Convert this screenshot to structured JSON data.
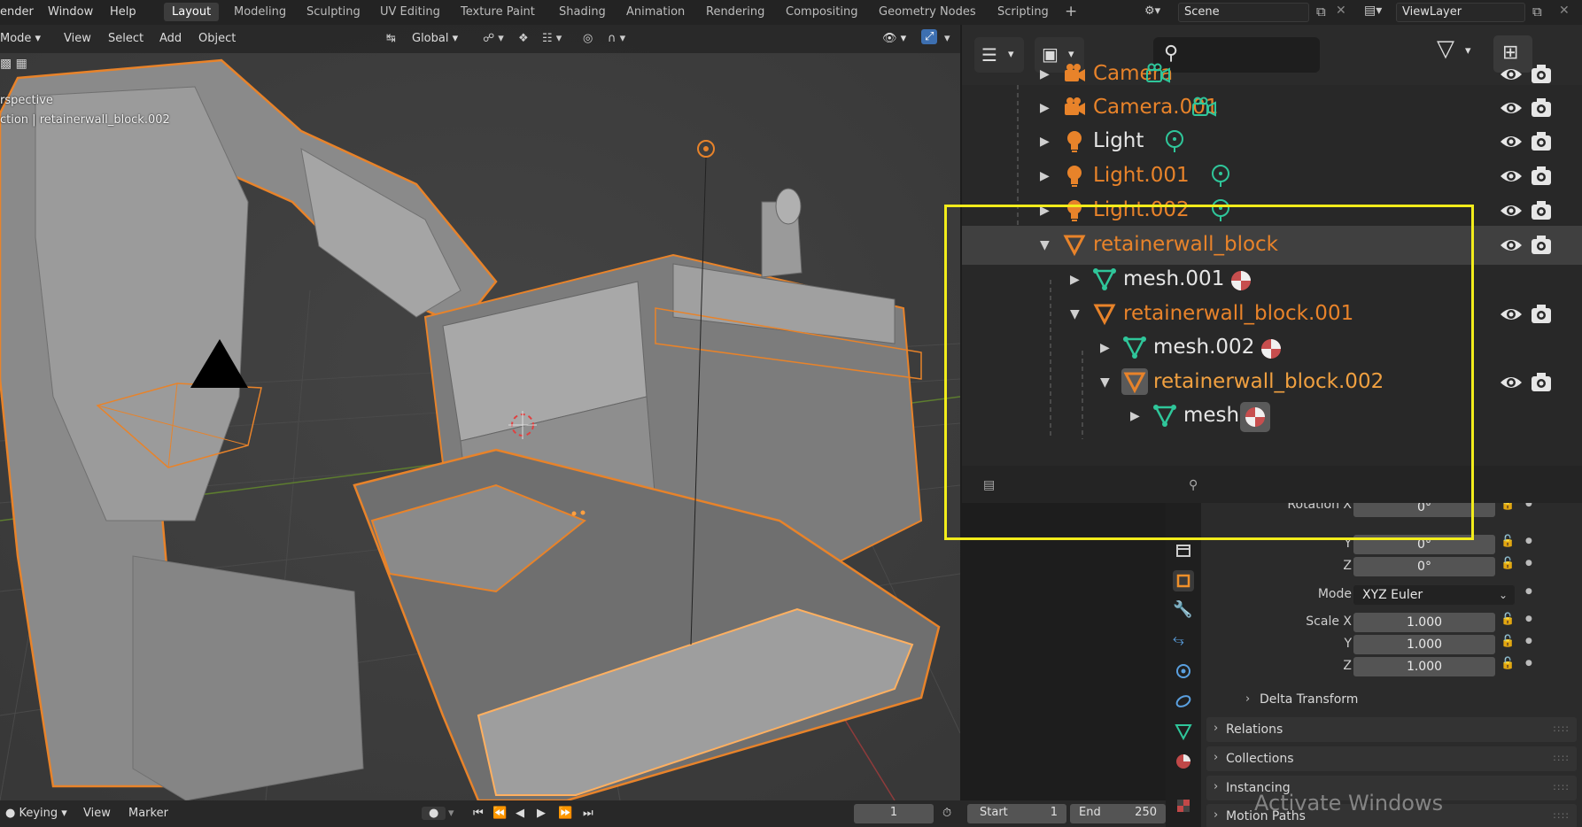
{
  "menu": {
    "items": [
      "ender",
      "Window",
      "Help"
    ],
    "workspaces": [
      "Layout",
      "Modeling",
      "Sculpting",
      "UV Editing",
      "Texture Paint",
      "Shading",
      "Animation",
      "Rendering",
      "Compositing",
      "Geometry Nodes",
      "Scripting"
    ],
    "add_tab": "+",
    "scene": "Scene",
    "view_layer": "ViewLayer"
  },
  "viewport": {
    "mode": "Mode",
    "menus": [
      "View",
      "Select",
      "Add",
      "Object"
    ],
    "transform_orientation": "Global",
    "overlay_line1": "rspective",
    "overlay_line2": "ction | retainerwall_block.002"
  },
  "outliner": {
    "search_placeholder": "",
    "rows": [
      {
        "name": "Camera",
        "color": "orange",
        "icon": "camera"
      },
      {
        "name": "Camera.001",
        "color": "orange",
        "icon": "camera"
      },
      {
        "name": "Light",
        "color": "white",
        "icon": "light"
      },
      {
        "name": "Light.001",
        "color": "orange",
        "icon": "light"
      },
      {
        "name": "Light.002",
        "color": "orange",
        "icon": "light"
      },
      {
        "name": "retainerwall_block",
        "color": "orange",
        "icon": "mesh"
      },
      {
        "name": "mesh.001",
        "color": "white",
        "icon": "meshdata"
      },
      {
        "name": "retainerwall_block.001",
        "color": "orange",
        "icon": "mesh"
      },
      {
        "name": "mesh.002",
        "color": "white",
        "icon": "meshdata"
      },
      {
        "name": "retainerwall_block.002",
        "color": "light-orange",
        "icon": "mesh"
      },
      {
        "name": "mesh",
        "color": "white",
        "icon": "meshdata"
      }
    ]
  },
  "properties": {
    "rotation_x_label": "Rotation X",
    "rotation_x": "0°",
    "y_label": "Y",
    "rotation_y": "0°",
    "z_label": "Z",
    "rotation_z": "0°",
    "mode_label": "Mode",
    "mode_value": "XYZ Euler",
    "scale_x_label": "Scale X",
    "scale_x": "1.000",
    "scale_y": "1.000",
    "scale_z": "1.000",
    "panels": [
      "Delta Transform",
      "Relations",
      "Collections",
      "Instancing",
      "Motion Paths"
    ]
  },
  "timeline": {
    "keying": "Keying",
    "view": "View",
    "marker": "Marker",
    "current_frame": "1",
    "start_label": "Start",
    "start": "1",
    "end_label": "End",
    "end": "250"
  },
  "watermark": "Activate Windows",
  "colors": {
    "selection_orange": "#e8832a",
    "highlight_yellow": "#f2ec1b",
    "mesh_green": "#2fc69a"
  }
}
